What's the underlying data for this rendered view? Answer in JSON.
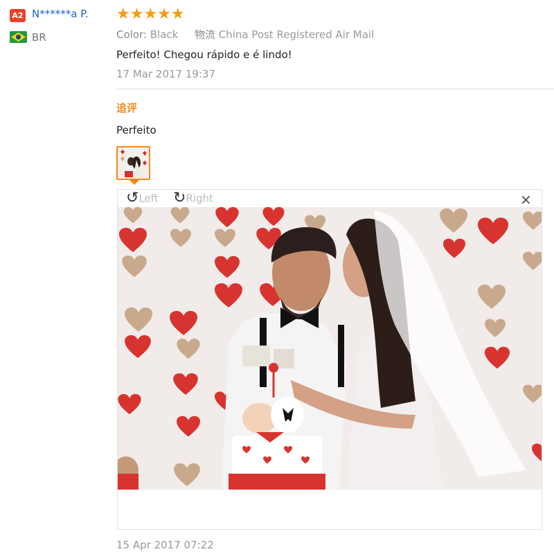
{
  "user": {
    "level_badge": "A2",
    "name": "N******a P.",
    "country_code": "BR",
    "flag_icon": "brazil-flag-icon"
  },
  "review": {
    "rating": 5,
    "stars": "★★★★★",
    "color_key": "Color:",
    "color_value": "Black",
    "shipping_key": "物流",
    "shipping_value": "China Post Registered Air Mail",
    "text": "Perfeito! Chegou rápido e é lindo!",
    "date": "17 Mar 2017 19:37"
  },
  "followup": {
    "label": "追评",
    "text": "Perfeito",
    "date": "15 Apr 2017 07:22"
  },
  "viewer": {
    "rotate_left_label": "Left",
    "rotate_right_label": "Right",
    "close_label": "×",
    "photo_alt": "Couple photo"
  },
  "colors": {
    "accent_orange": "#f08a1c",
    "star_color": "#f39c12",
    "name_blue": "#1c62c9",
    "badge_red": "#e8422b"
  }
}
